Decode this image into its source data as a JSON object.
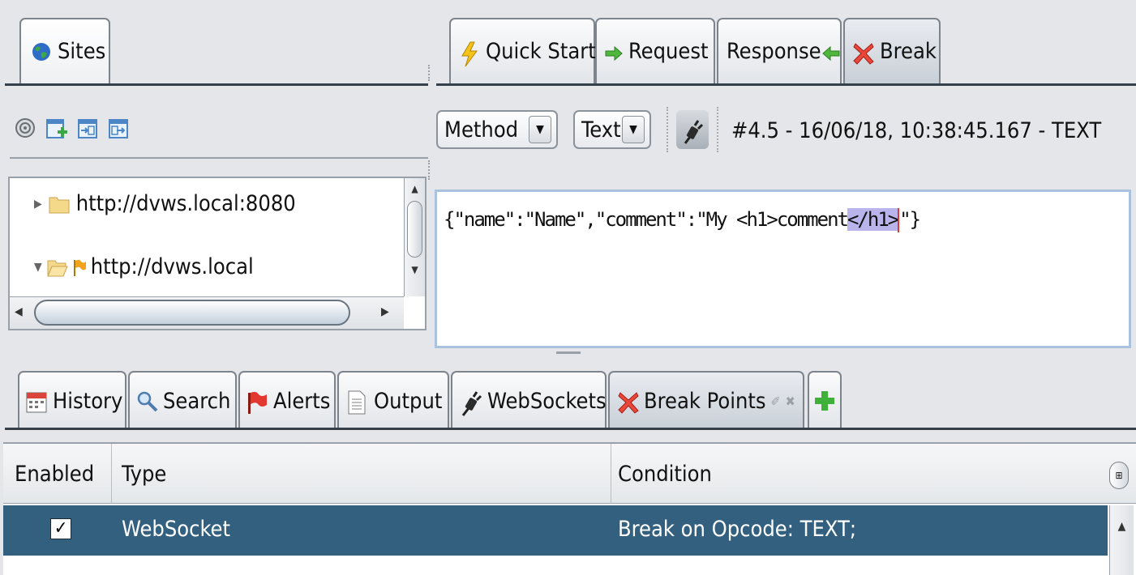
{
  "top_left_tabs": [
    {
      "label": "Sites",
      "icon": "globe-icon"
    }
  ],
  "top_right_tabs": [
    {
      "label": "Quick Start",
      "icon": "lightning-icon"
    },
    {
      "label": "Request",
      "icon": "arrow-right-icon"
    },
    {
      "label": "Response",
      "icon": "arrow-left-icon"
    },
    {
      "label": "Break",
      "icon": "red-x-icon",
      "active": true
    }
  ],
  "sites_toolbar": [
    "target-icon",
    "new-context-icon",
    "import-context-icon",
    "export-context-icon"
  ],
  "sites_tree": [
    {
      "label": "http://dvws.local:8080",
      "expanded": false
    },
    {
      "label": "http://dvws.local",
      "expanded": true
    }
  ],
  "break_panel": {
    "method_select": "Method",
    "view_select": "Text",
    "message_info": "#4.5 - 16/06/18, 10:38:45.167 - TEXT",
    "payload": {
      "prefix": "{\"name\":\"Name\",\"comment\":\"My <h1>comment",
      "selected": "</h1>",
      "suffix": "\"}"
    }
  },
  "bottom_tabs": [
    {
      "label": "History",
      "icon": "calendar-icon"
    },
    {
      "label": "Search",
      "icon": "magnifier-icon"
    },
    {
      "label": "Alerts",
      "icon": "flag-icon"
    },
    {
      "label": "Output",
      "icon": "document-icon"
    },
    {
      "label": "WebSockets",
      "icon": "plug-icon"
    },
    {
      "label": "Break Points",
      "icon": "red-x-icon",
      "active": true
    }
  ],
  "break_points_table": {
    "columns": [
      "Enabled",
      "Type",
      "Condition"
    ],
    "rows": [
      {
        "enabled": true,
        "type": "WebSocket",
        "condition": "Break on Opcode: TEXT;"
      }
    ]
  },
  "colors": {
    "selection_row": "#33607f",
    "payload_highlight": "#b9b4ec",
    "accent_red": "#e2382f"
  }
}
